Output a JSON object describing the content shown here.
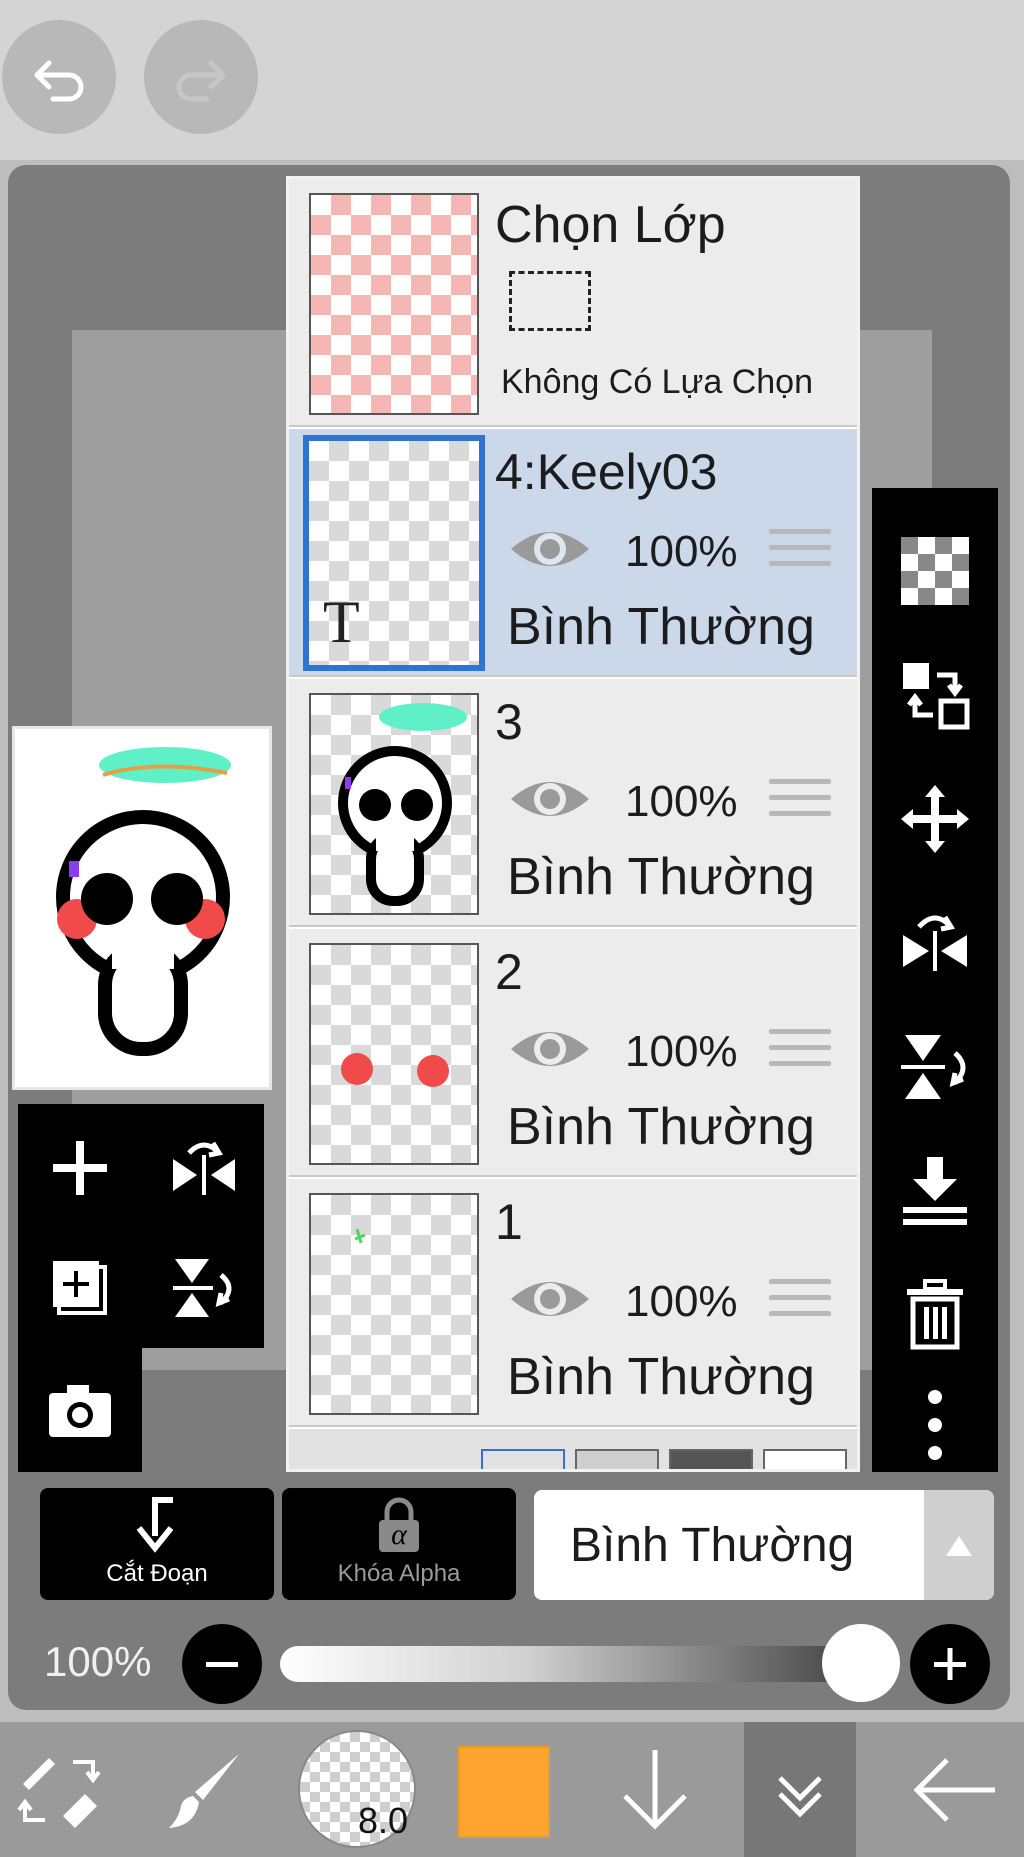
{
  "top": {
    "undo_icon": "undo-icon",
    "redo_icon": "redo-icon"
  },
  "layer_panel": {
    "selection_layer": {
      "title": "Chọn Lớp",
      "status": "Không Có Lựa Chọn"
    },
    "layers": [
      {
        "name": "4:Keely03",
        "opacity": "100%",
        "blend": "Bình Thường",
        "selected": true,
        "text_glyph": "T"
      },
      {
        "name": "3",
        "opacity": "100%",
        "blend": "Bình Thường",
        "selected": false
      },
      {
        "name": "2",
        "opacity": "100%",
        "blend": "Bình Thường",
        "selected": false
      },
      {
        "name": "1",
        "opacity": "100%",
        "blend": "Bình Thường",
        "selected": false
      }
    ]
  },
  "actions": {
    "clip_label": "Cắt Đoạn",
    "alpha_lock_label": "Khóa Alpha",
    "alpha_glyph": "α",
    "blend_mode": "Bình Thường"
  },
  "opacity_slider": {
    "label": "100%",
    "value": 1.0
  },
  "bottom_bar": {
    "brush_size": "8.0",
    "color": "#ffa42e"
  },
  "colors": {
    "accent_blue": "#2f73d3",
    "selected_row": "#cbd8ea",
    "brush_color": "#ffa42e"
  }
}
